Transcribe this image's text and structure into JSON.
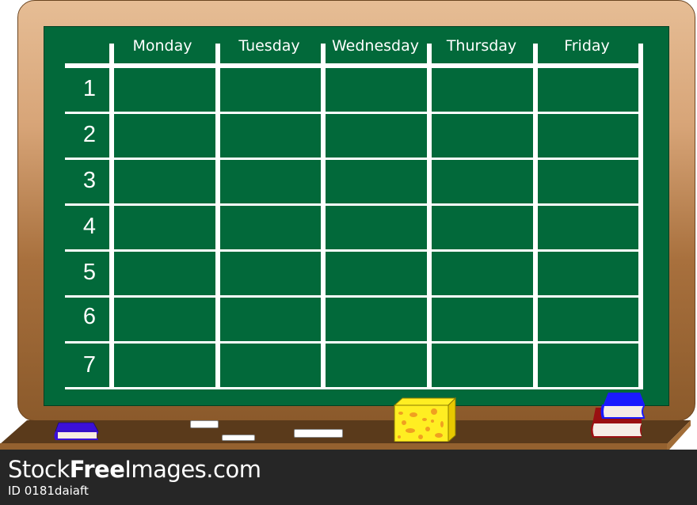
{
  "timetable": {
    "days": [
      "Monday",
      "Tuesday",
      "Wednesday",
      "Thursday",
      "Friday"
    ],
    "periods": [
      "1",
      "2",
      "3",
      "4",
      "5",
      "6",
      "7"
    ]
  },
  "watermark": {
    "brand_prefix": "Stock",
    "brand_bold": "Free",
    "brand_suffix": "Images.com",
    "image_id": "ID 0181daiaft"
  },
  "colors": {
    "board_green": "#02693a",
    "chalk_line": "#ffffff",
    "frame_light": "#e6bd95",
    "frame_dark": "#8b5a2b",
    "ledge": "#5a3a1b",
    "sponge": "#ffee22",
    "book_blue": "#1a1aff",
    "book_red": "#9a0f12",
    "footer": "#262626"
  }
}
